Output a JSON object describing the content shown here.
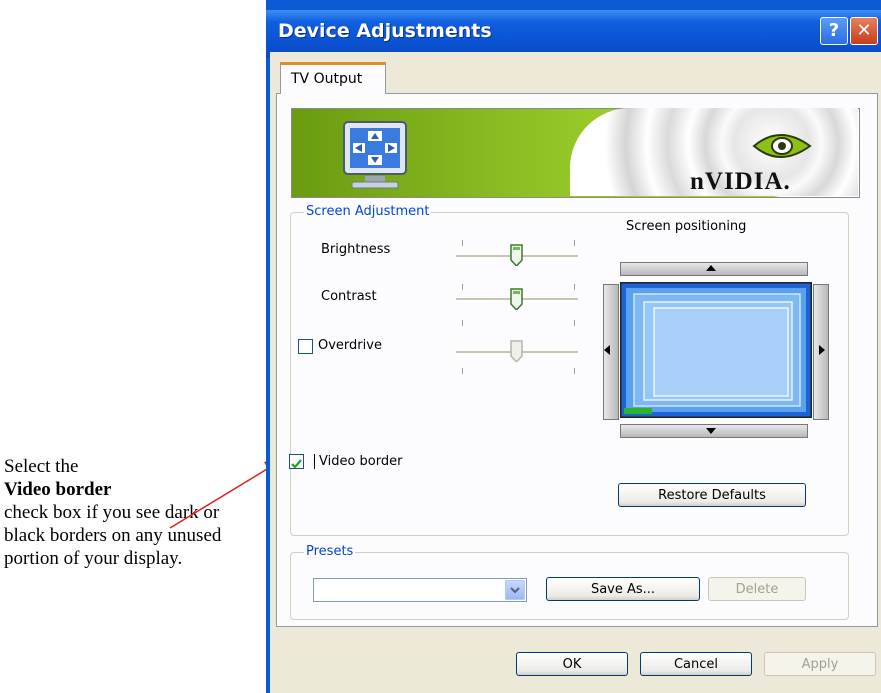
{
  "annotation": {
    "line1": "Select the",
    "bold": "Video border",
    "rest": "check box if you see dark or black borders on any unused portion of your display."
  },
  "window": {
    "title": "Device Adjustments",
    "help_glyph": "?",
    "close_glyph": "✕"
  },
  "tabs": [
    {
      "label": "TV Output"
    }
  ],
  "banner": {
    "brand": "nVIDIA."
  },
  "screen_adjustment": {
    "legend": "Screen Adjustment",
    "sliders": [
      {
        "label": "Brightness",
        "value": 0.5
      },
      {
        "label": "Contrast",
        "value": 0.5
      },
      {
        "label": "Overdrive",
        "value": 0.5
      }
    ],
    "overdrive_checked": false,
    "video_border_label": "Video border",
    "video_border_checked": true,
    "positioning_label": "Screen positioning",
    "restore_defaults": "Restore Defaults"
  },
  "presets": {
    "legend": "Presets",
    "selected": "",
    "save_as": "Save As...",
    "delete": "Delete"
  },
  "footer": {
    "ok": "OK",
    "cancel": "Cancel",
    "apply": "Apply"
  },
  "colors": {
    "title_blue": "#0a52d2",
    "legend_blue": "#0046d5",
    "nvidia_green": "#9acb2a",
    "arrow_red": "#e0201a"
  }
}
